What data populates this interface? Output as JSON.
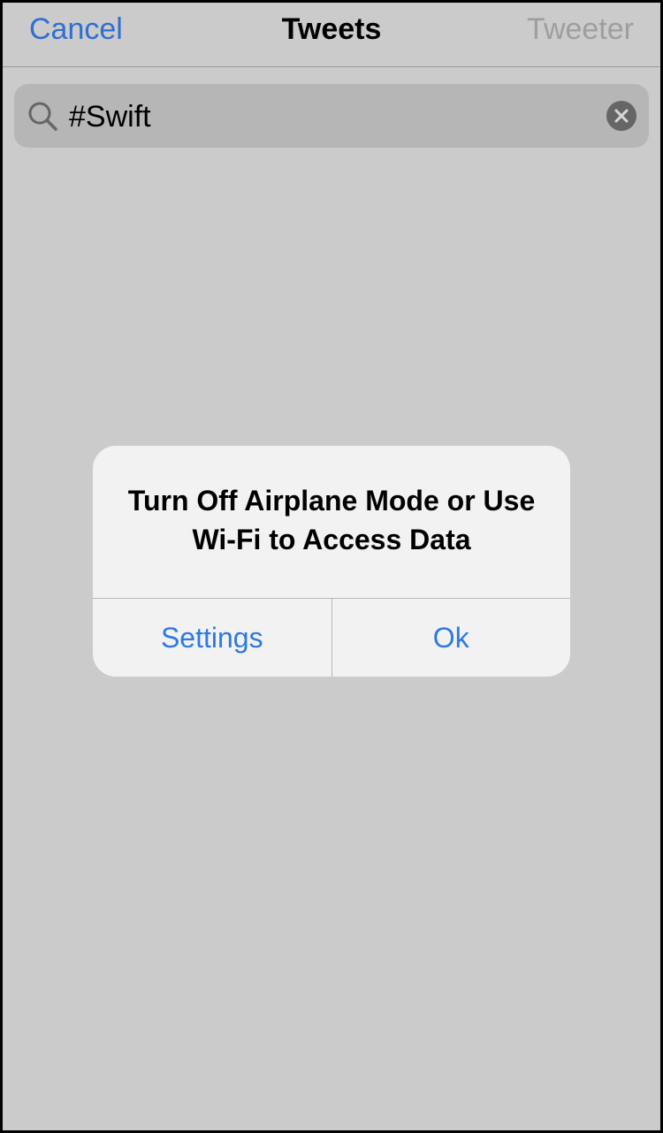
{
  "navbar": {
    "cancel_label": "Cancel",
    "title": "Tweets",
    "tweeter_label": "Tweeter"
  },
  "search": {
    "value": "#Swift",
    "icon": "search-icon",
    "clear_icon": "clear-icon"
  },
  "alert": {
    "title": "Turn Off Airplane Mode or Use Wi-Fi to Access Data",
    "buttons": [
      {
        "label": "Settings"
      },
      {
        "label": "Ok"
      }
    ]
  },
  "colors": {
    "accent": "#2f79e3",
    "disabled": "#9e9e9e",
    "background": "#cbcbcb",
    "alert_background": "#f2f2f2"
  }
}
